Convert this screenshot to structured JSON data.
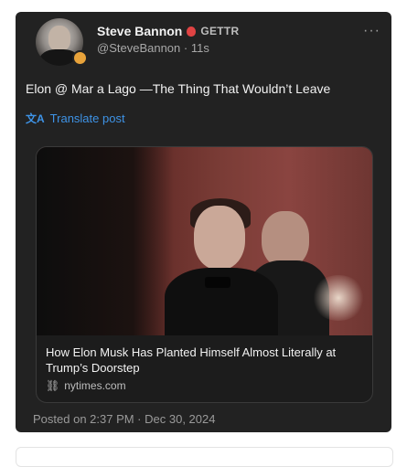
{
  "post": {
    "author_name": "Steve Bannon",
    "platform_badge": "GETTR",
    "handle": "@SteveBannon",
    "relative_time": "11s",
    "more_label": "···",
    "text": "Elon @ Mar a Lago —The Thing That Wouldn’t Leave",
    "translate_icon": "translate-icon",
    "translate_label": "Translate post",
    "posted_at": "Posted on 2:37 PM · Dec 30, 2024"
  },
  "link_preview": {
    "title": "How Elon Musk Has Planted Himself Almost Literally at Trump’s Doorstep",
    "domain": "nytimes.com"
  },
  "colors": {
    "card_bg": "#222222",
    "accent_link": "#3e93e6",
    "gettr_red": "#e04343"
  }
}
